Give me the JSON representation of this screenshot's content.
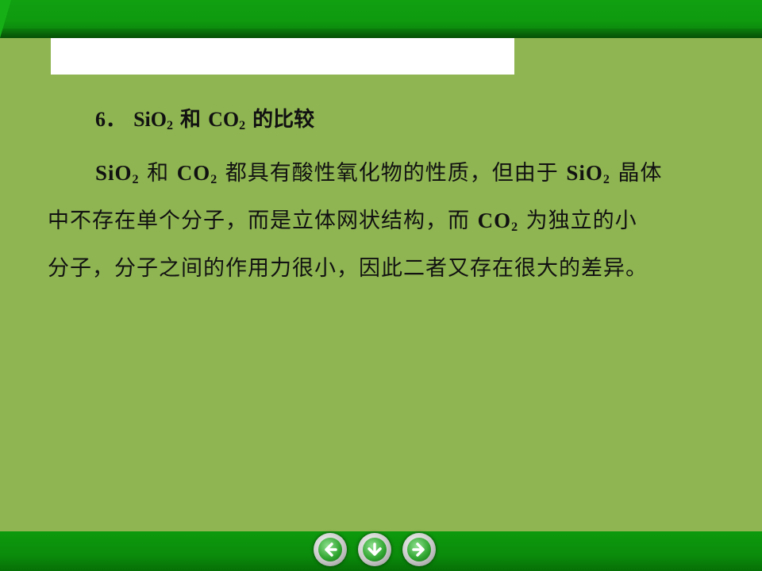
{
  "heading": {
    "number": "6．",
    "sio2_base": "SiO",
    "sub": "2",
    "he": " 和 ",
    "co2_base": "CO",
    "tail": " 的比较"
  },
  "paragraph": {
    "l1_a": "SiO",
    "l1_sub1": "2",
    "l1_b": " 和 ",
    "l1_c": "CO",
    "l1_sub2": "2",
    "l1_d": " 都具有酸性氧化物的性质，但由于 ",
    "l1_e": "SiO",
    "l1_sub3": "2",
    "l1_f": " 晶体",
    "l2_a": "中不存在单个分子，而是立体网状结构，而 ",
    "l2_b": "CO",
    "l2_sub": "2",
    "l2_c": " 为独立的小",
    "l3": "分子，分子之间的作用力很小，因此二者又存在很大的差异。"
  },
  "nav": {
    "prev_icon": "left-arrow-icon",
    "down_icon": "down-arrow-icon",
    "next_icon": "right-arrow-icon"
  },
  "colors": {
    "background": "#8fb552",
    "bar": "#0f9a0f"
  }
}
